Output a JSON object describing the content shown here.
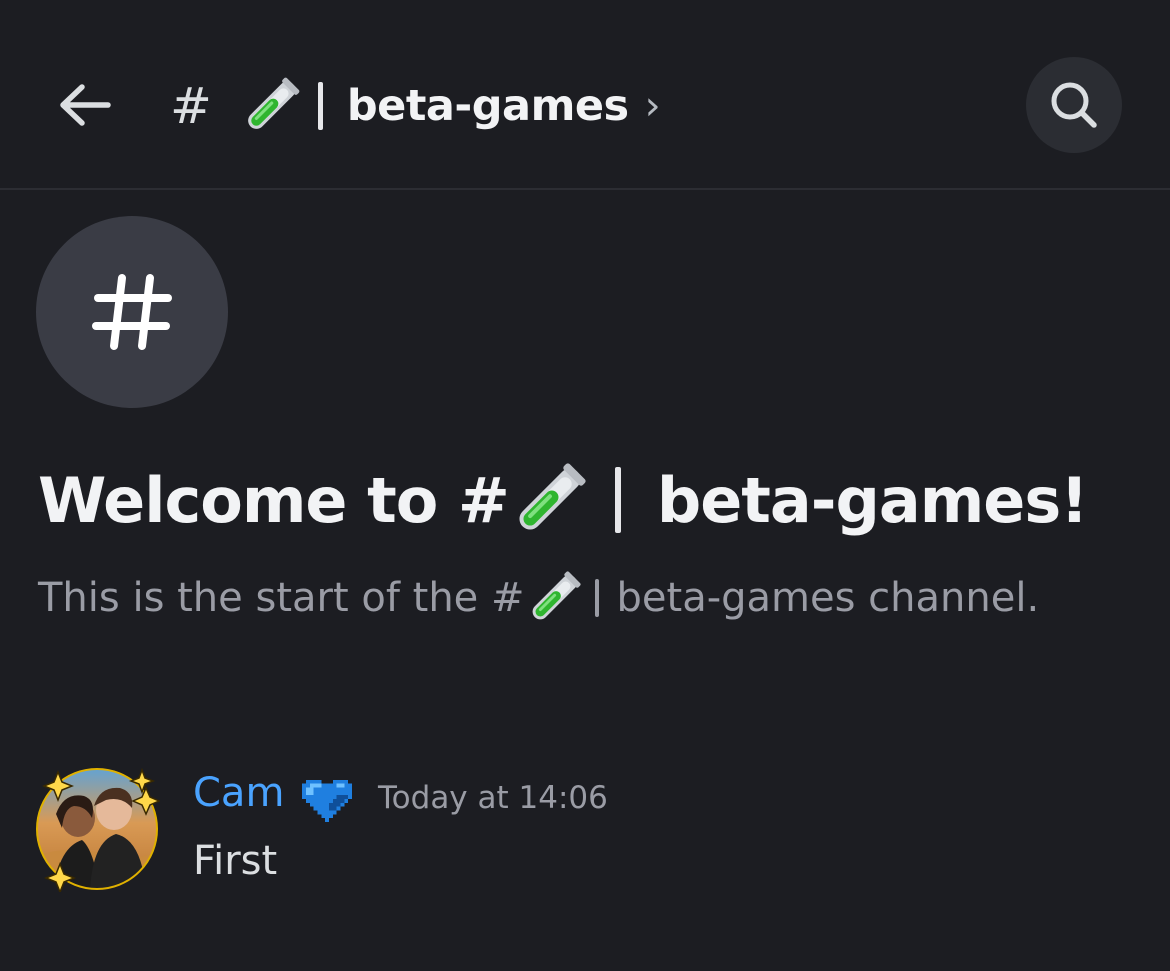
{
  "header": {
    "back_icon": "arrow-left-icon",
    "hash": "#",
    "channel_emoji": "test-tube-icon",
    "channel_name": "beta-games",
    "chevron": "›",
    "search_icon": "search-icon"
  },
  "welcome": {
    "avatar_icon": "hash-icon",
    "title_prefix": "Welcome to #",
    "title_suffix": "beta-games!",
    "subtitle_prefix": "This is the start of the #",
    "subtitle_suffix": "beta-games channel."
  },
  "message": {
    "author": "Cam",
    "author_badge": "blue-heart-icon",
    "timestamp": "Today at 14:06",
    "text": "First"
  },
  "colors": {
    "background": "#1c1d22",
    "author": "#4aa3ff",
    "muted": "#9a9ca5",
    "tube_liquid": "#2fb52f"
  }
}
